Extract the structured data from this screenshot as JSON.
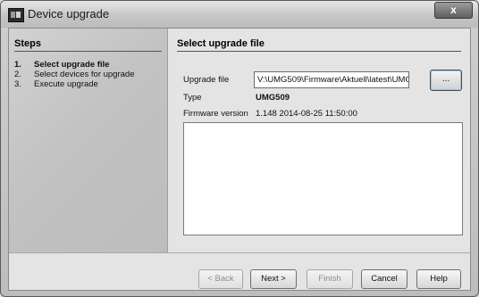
{
  "window": {
    "title": "Device upgrade",
    "close_label": "x"
  },
  "steps": {
    "header": "Steps",
    "items": [
      {
        "num": "1.",
        "label": "Select upgrade file"
      },
      {
        "num": "2.",
        "label": "Select devices for upgrade"
      },
      {
        "num": "3.",
        "label": "Execute upgrade"
      }
    ]
  },
  "main": {
    "header": "Select upgrade file",
    "upgrade_file_label": "Upgrade file",
    "upgrade_file_value": "V:\\UMG509\\Firmware\\Aktuell\\latest\\UMG",
    "browse_label": "...",
    "type_label": "Type",
    "type_value": "UMG509",
    "firmware_label": "Firmware version",
    "firmware_value": "1.148 2014-08-25 11:50:00"
  },
  "buttons": {
    "back": "< Back",
    "next": "Next >",
    "finish": "Finish",
    "cancel": "Cancel",
    "help": "Help"
  }
}
